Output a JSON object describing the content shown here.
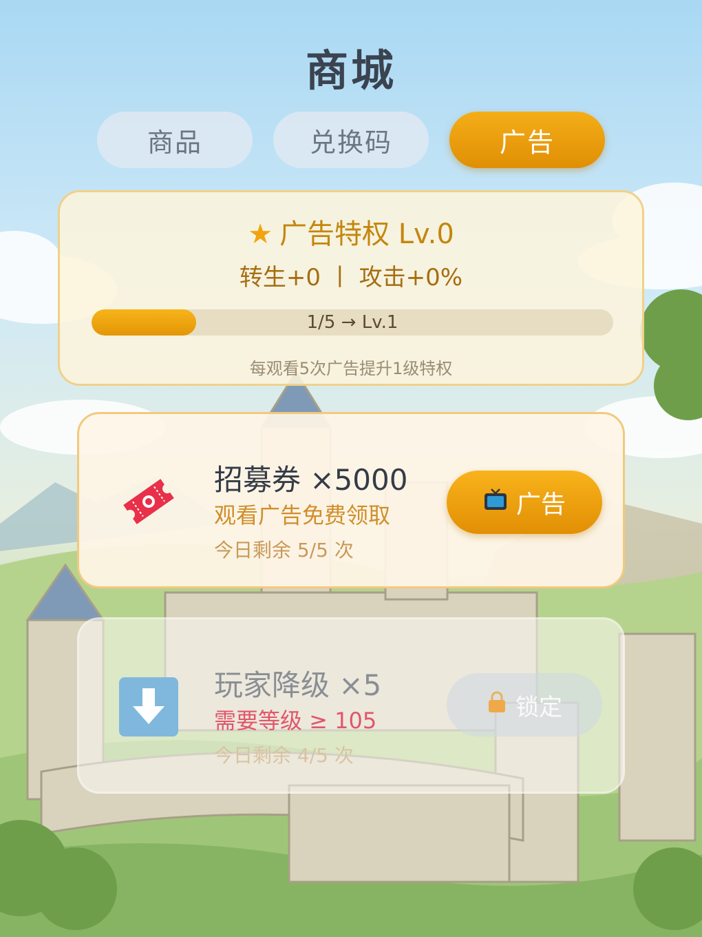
{
  "header": {
    "title": "商城"
  },
  "tabs": [
    {
      "label": "商品",
      "active": false
    },
    {
      "label": "兑换码",
      "active": false
    },
    {
      "label": "广告",
      "active": true
    }
  ],
  "privilege": {
    "title": "广告特权 Lv.0",
    "stats": "转生+0 丨 攻击+0%",
    "progress_fraction": 0.2,
    "progress_label": "1/5 → Lv.1",
    "hint": "每观看5次广告提升1级特权"
  },
  "offers": [
    {
      "name": "招募券 ×5000",
      "description": "观看广告免费领取",
      "remaining": "今日剩余 5/5 次",
      "button_label": "广告",
      "icon": "ticket-icon",
      "locked": false
    },
    {
      "name": "玩家降级 ×5",
      "description": "需要等级 ≥ 105",
      "remaining": "今日剩余 4/5 次",
      "button_label": "锁定",
      "icon": "arrow-down-icon",
      "locked": true
    }
  ],
  "colors": {
    "accent": "#e9a00f",
    "title_text": "#3b4350",
    "warning_text": "#e0566b",
    "ticket": "#e8304a",
    "downgrade_icon": "#7fb8dc"
  }
}
